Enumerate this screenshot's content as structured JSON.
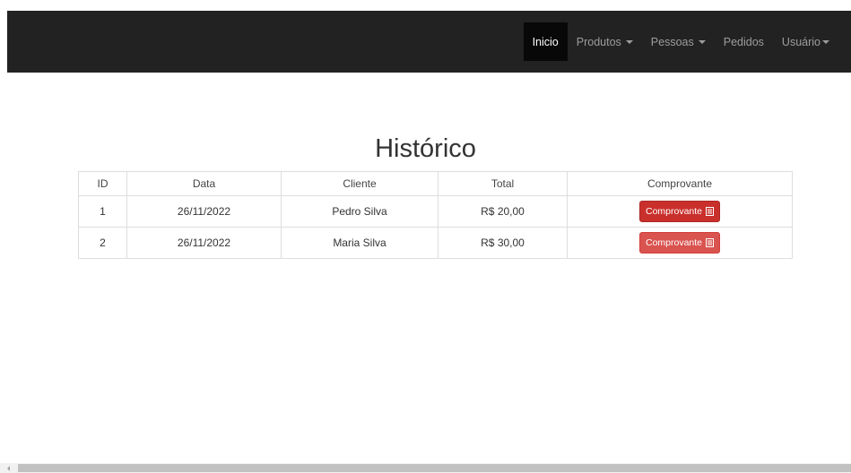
{
  "navbar": {
    "items": [
      {
        "label": "Inicio",
        "active": true
      },
      {
        "label": "Produtos",
        "dropdown": true
      },
      {
        "label": "Pessoas",
        "dropdown": true
      },
      {
        "label": "Pedidos"
      },
      {
        "label": "Usuário",
        "dropdown": true
      }
    ],
    "background": "#222222",
    "active_background": "#080808"
  },
  "page": {
    "title": "Histórico"
  },
  "table": {
    "headers": [
      "ID",
      "Data",
      "Cliente",
      "Total",
      "Comprovante"
    ],
    "rows": [
      {
        "id": "1",
        "data": "26/11/2022",
        "cliente": "Pedro Silva",
        "total": "R$ 20,00",
        "button_label": "Comprovante",
        "button_icon": "list-alt-icon"
      },
      {
        "id": "2",
        "data": "26/11/2022",
        "cliente": "Maria Silva",
        "total": "R$ 30,00",
        "button_label": "Comprovante",
        "button_icon": "list-alt-icon"
      }
    ]
  },
  "colors": {
    "button_danger": "#d9534f"
  }
}
